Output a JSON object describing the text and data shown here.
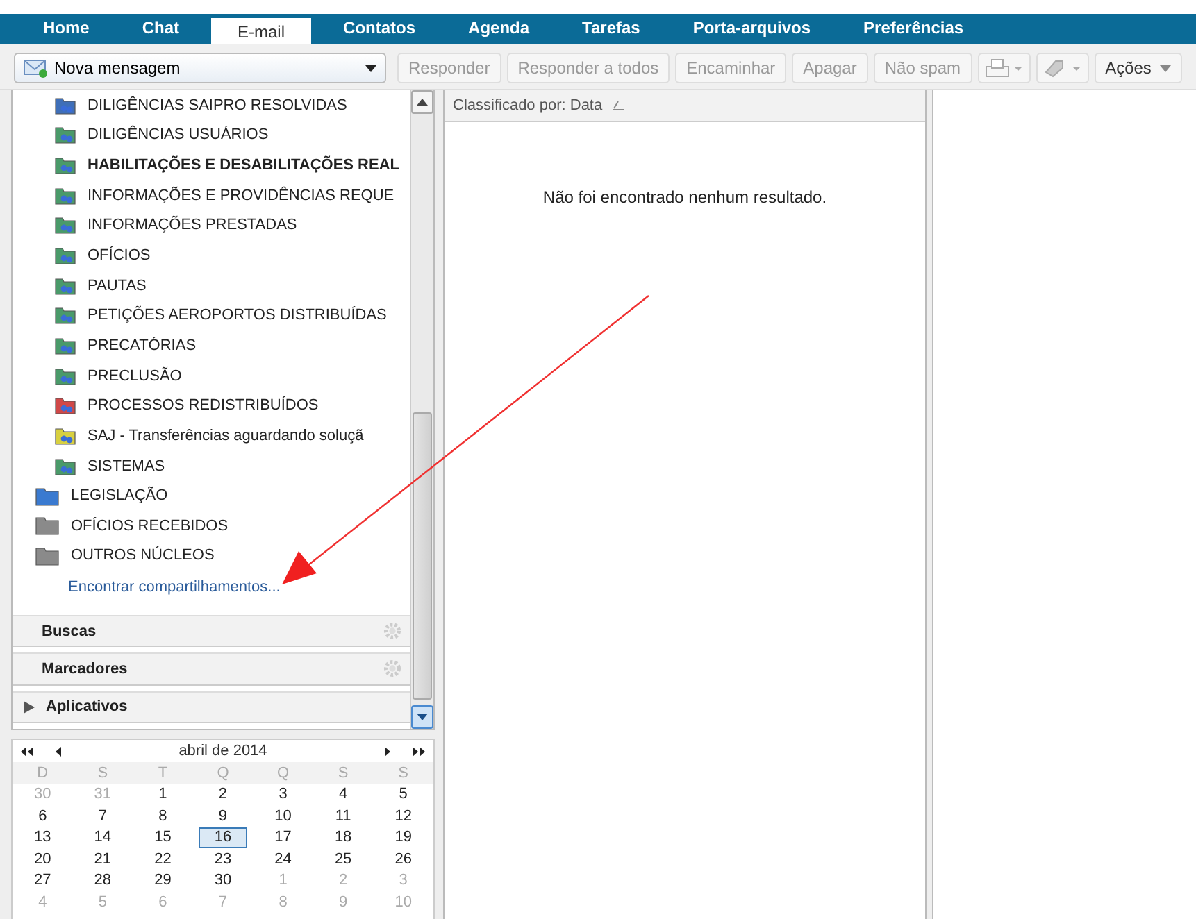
{
  "tabs": [
    {
      "label": "Home",
      "selected": false
    },
    {
      "label": "Chat",
      "selected": false
    },
    {
      "label": "E-mail",
      "selected": true
    },
    {
      "label": "Contatos",
      "selected": false
    },
    {
      "label": "Agenda",
      "selected": false
    },
    {
      "label": "Tarefas",
      "selected": false
    },
    {
      "label": "Porta-arquivos",
      "selected": false
    },
    {
      "label": "Preferências",
      "selected": false
    }
  ],
  "toolbar": {
    "new_message": "Nova mensagem",
    "buttons": [
      {
        "kind": "text",
        "label": "Responder",
        "disabled": true
      },
      {
        "kind": "text",
        "label": "Responder a todos",
        "disabled": true
      },
      {
        "kind": "text",
        "label": "Encaminhar",
        "disabled": true
      },
      {
        "kind": "text",
        "label": "Apagar",
        "disabled": true
      },
      {
        "kind": "text",
        "label": "Não spam",
        "disabled": true
      },
      {
        "kind": "print",
        "disabled": true
      },
      {
        "kind": "tag",
        "disabled": true
      },
      {
        "kind": "text",
        "label": "Ações",
        "disabled": false,
        "menu": true
      }
    ]
  },
  "subfolders": [
    {
      "label": "DILIGÊNCIAS SAIPRO RESOLVIDAS",
      "color": "#3f6fb8",
      "unread": false
    },
    {
      "label": "DILIGÊNCIAS USUÁRIOS",
      "color": "#4a9a6a",
      "unread": false
    },
    {
      "label": "HABILITAÇÕES E DESABILITAÇÕES REAL",
      "color": "#4a9a6a",
      "unread": true
    },
    {
      "label": "INFORMAÇÕES E PROVIDÊNCIAS REQUE",
      "color": "#4a9a6a",
      "unread": false
    },
    {
      "label": "INFORMAÇÕES PRESTADAS",
      "color": "#4a9a6a",
      "unread": false
    },
    {
      "label": "OFÍCIOS",
      "color": "#4a9a6a",
      "unread": false
    },
    {
      "label": "PAUTAS",
      "color": "#4a9a6a",
      "unread": false
    },
    {
      "label": "PETIÇÕES AEROPORTOS DISTRIBUÍDAS",
      "color": "#4a9a6a",
      "unread": false
    },
    {
      "label": "PRECATÓRIAS",
      "color": "#4a9a6a",
      "unread": false
    },
    {
      "label": "PRECLUSÃO",
      "color": "#4a9a6a",
      "unread": false
    },
    {
      "label": "PROCESSOS REDISTRIBUÍDOS",
      "color": "#d04848",
      "unread": false
    },
    {
      "label": "SAJ - Transferências aguardando soluçã",
      "color": "#d8d040",
      "unread": false
    },
    {
      "label": "SISTEMAS",
      "color": "#4a9a6a",
      "unread": false
    }
  ],
  "folders": [
    {
      "label": "LEGISLAÇÃO",
      "color": "#3a7ad0"
    },
    {
      "label": "OFÍCIOS RECEBIDOS",
      "color": "#8a8a8a"
    },
    {
      "label": "OUTROS NÚCLEOS",
      "color": "#8a8a8a"
    }
  ],
  "find_shares": "Encontrar compartilhamentos...",
  "sections": [
    {
      "label": "Buscas",
      "kind": "gear"
    },
    {
      "label": "Marcadores",
      "kind": "gear"
    },
    {
      "label": "Aplicativos",
      "kind": "expand"
    }
  ],
  "calendar": {
    "month": "abril de 2014",
    "weekdays": [
      "D",
      "S",
      "T",
      "Q",
      "Q",
      "S",
      "S"
    ],
    "weeks": [
      [
        {
          "d": "30",
          "muted": true
        },
        {
          "d": "31",
          "muted": true
        },
        {
          "d": "1",
          "muted": false
        },
        {
          "d": "2",
          "muted": false
        },
        {
          "d": "3",
          "muted": false
        },
        {
          "d": "4",
          "muted": false
        },
        {
          "d": "5",
          "muted": false
        }
      ],
      [
        {
          "d": "6",
          "muted": false
        },
        {
          "d": "7",
          "muted": false
        },
        {
          "d": "8",
          "muted": false
        },
        {
          "d": "9",
          "muted": false
        },
        {
          "d": "10",
          "muted": false
        },
        {
          "d": "11",
          "muted": false
        },
        {
          "d": "12",
          "muted": false
        }
      ],
      [
        {
          "d": "13",
          "muted": false
        },
        {
          "d": "14",
          "muted": false
        },
        {
          "d": "15",
          "muted": false
        },
        {
          "d": "16",
          "muted": false,
          "selected": true
        },
        {
          "d": "17",
          "muted": false
        },
        {
          "d": "18",
          "muted": false
        },
        {
          "d": "19",
          "muted": false
        }
      ],
      [
        {
          "d": "20",
          "muted": false
        },
        {
          "d": "21",
          "muted": false
        },
        {
          "d": "22",
          "muted": false
        },
        {
          "d": "23",
          "muted": false
        },
        {
          "d": "24",
          "muted": false
        },
        {
          "d": "25",
          "muted": false
        },
        {
          "d": "26",
          "muted": false
        }
      ],
      [
        {
          "d": "27",
          "muted": false
        },
        {
          "d": "28",
          "muted": false
        },
        {
          "d": "29",
          "muted": false
        },
        {
          "d": "30",
          "muted": false
        },
        {
          "d": "1",
          "muted": true
        },
        {
          "d": "2",
          "muted": true
        },
        {
          "d": "3",
          "muted": true
        }
      ],
      [
        {
          "d": "4",
          "muted": true
        },
        {
          "d": "5",
          "muted": true
        },
        {
          "d": "6",
          "muted": true
        },
        {
          "d": "7",
          "muted": true
        },
        {
          "d": "8",
          "muted": true
        },
        {
          "d": "9",
          "muted": true
        },
        {
          "d": "10",
          "muted": true
        }
      ]
    ]
  },
  "list": {
    "sort": "Classificado por: Data",
    "empty": "Não foi encontrado nenhum resultado."
  }
}
